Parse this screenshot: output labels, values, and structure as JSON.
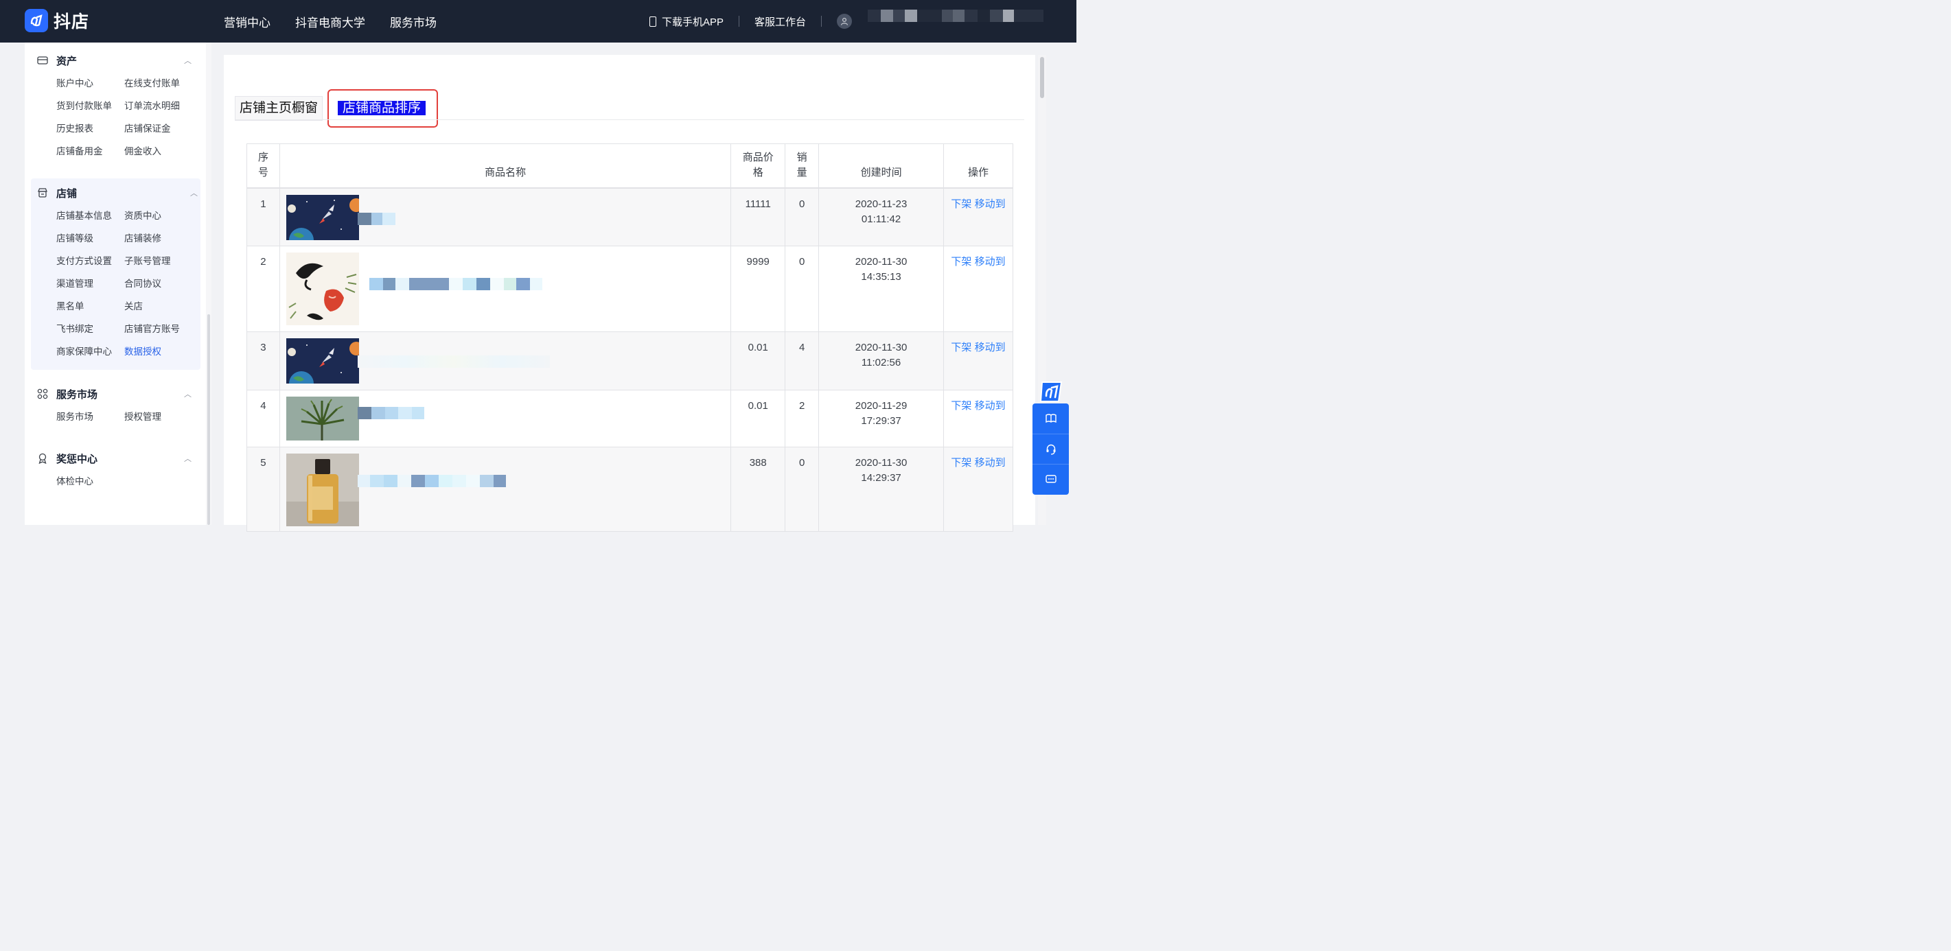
{
  "brand": {
    "name": "抖店"
  },
  "topnav": {
    "items": [
      "营销中心",
      "抖音电商大学",
      "服务市场"
    ]
  },
  "topright": {
    "download": "下载手机APP",
    "service": "客服工作台"
  },
  "sidebar": {
    "groups": [
      {
        "title": "资产",
        "icon": "card-icon",
        "items": [
          "账户中心",
          "在线支付账单",
          "货到付款账单",
          "订单流水明细",
          "历史报表",
          "店铺保证金",
          "店铺备用金",
          "佣金收入"
        ]
      },
      {
        "title": "店铺",
        "icon": "shop-icon",
        "items": [
          "店铺基本信息",
          "资质中心",
          "店铺等级",
          "店铺装修",
          "支付方式设置",
          "子账号管理",
          "渠道管理",
          "合同协议",
          "黑名单",
          "关店",
          "飞书绑定",
          "店铺官方账号",
          "商家保障中心",
          "数据授权"
        ],
        "active": "数据授权"
      },
      {
        "title": "服务市场",
        "icon": "grid-icon",
        "items": [
          "服务市场",
          "授权管理"
        ]
      },
      {
        "title": "奖惩中心",
        "icon": "medal-icon",
        "items": [
          "体检中心"
        ]
      }
    ]
  },
  "tabs": {
    "tab1": "店铺主页橱窗",
    "tab2": "店铺商品排序"
  },
  "table": {
    "headers": {
      "index": "序号",
      "name": "商品名称",
      "price": "商品价格",
      "sales": "销量",
      "created": "创建时间",
      "ops": "操作"
    },
    "rows": [
      {
        "index": "1",
        "price": "11111",
        "sales": "0",
        "date": "2020-11-23",
        "time": "01:11:42",
        "op1": "下架",
        "op2": "移动到",
        "image": "rocket-space-image"
      },
      {
        "index": "2",
        "price": "9999",
        "sales": "0",
        "date": "2020-11-30",
        "time": "14:35:13",
        "op1": "下架",
        "op2": "移动到",
        "image": "ink-koi-image"
      },
      {
        "index": "3",
        "price": "0.01",
        "sales": "4",
        "date": "2020-11-30",
        "time": "11:02:56",
        "op1": "下架",
        "op2": "移动到",
        "image": "rocket-space-image"
      },
      {
        "index": "4",
        "price": "0.01",
        "sales": "2",
        "date": "2020-11-29",
        "time": "17:29:37",
        "op1": "下架",
        "op2": "移动到",
        "image": "plant-image"
      },
      {
        "index": "5",
        "price": "388",
        "sales": "0",
        "date": "2020-11-30",
        "time": "14:29:37",
        "op1": "下架",
        "op2": "移动到",
        "image": "perfume-image"
      }
    ]
  },
  "colors": {
    "topbar": "#1b2333",
    "accent": "#2d7ff9",
    "tab_active": "#1010ee",
    "highlight_box": "#e2403c"
  }
}
